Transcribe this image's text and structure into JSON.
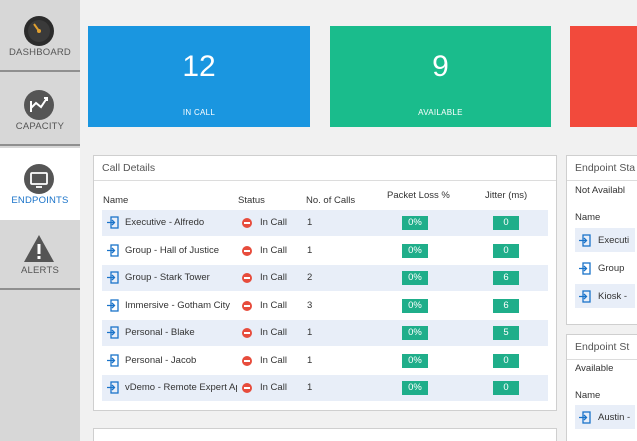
{
  "sidebar": {
    "items": [
      {
        "label": "DASHBOARD",
        "icon": "gauge-icon",
        "active": false
      },
      {
        "label": "CAPACITY",
        "icon": "chart-icon",
        "active": false
      },
      {
        "label": "ENDPOINTS",
        "icon": "monitor-icon",
        "active": true
      },
      {
        "label": "ALERTS",
        "icon": "warning-icon",
        "active": false
      }
    ]
  },
  "kpis": [
    {
      "value": "12",
      "label": "IN CALL",
      "color": "#1a96e0"
    },
    {
      "value": "9",
      "label": "AVAILABLE",
      "color": "#1abc8c"
    },
    {
      "value": "",
      "label": "",
      "color": "#f24a3c"
    }
  ],
  "call_details": {
    "title": "Call Details",
    "columns": [
      "Name",
      "Status",
      "No. of Calls",
      "Packet Loss %",
      "Jitter (ms)"
    ],
    "rows": [
      {
        "name": "Executive - Alfredo",
        "status": "In Call",
        "calls": "1",
        "packet_loss": "0%",
        "jitter": "0"
      },
      {
        "name": "Group - Hall of Justice",
        "status": "In Call",
        "calls": "1",
        "packet_loss": "0%",
        "jitter": "0"
      },
      {
        "name": "Group - Stark Tower",
        "status": "In Call",
        "calls": "2",
        "packet_loss": "0%",
        "jitter": "6"
      },
      {
        "name": "Immersive - Gotham City",
        "status": "In Call",
        "calls": "3",
        "packet_loss": "0%",
        "jitter": "6"
      },
      {
        "name": "Personal - Blake",
        "status": "In Call",
        "calls": "1",
        "packet_loss": "0%",
        "jitter": "5"
      },
      {
        "name": "Personal - Jacob",
        "status": "In Call",
        "calls": "1",
        "packet_loss": "0%",
        "jitter": "0"
      },
      {
        "name": "vDemo - Remote Expert Ap",
        "status": "In Call",
        "calls": "1",
        "packet_loss": "0%",
        "jitter": "0"
      }
    ]
  },
  "endpoint_status_1": {
    "title": "Endpoint Sta",
    "subtitle": "Not Availabl",
    "name_header": "Name",
    "rows": [
      "Executi",
      "Group",
      "Kiosk -"
    ]
  },
  "endpoint_status_2": {
    "title": "Endpoint St",
    "subtitle": "Available",
    "name_header": "Name",
    "rows": [
      "Austin -"
    ]
  },
  "colors": {
    "accent": "#1a73c9",
    "success": "#1fae8a",
    "danger": "#e74c3c"
  }
}
